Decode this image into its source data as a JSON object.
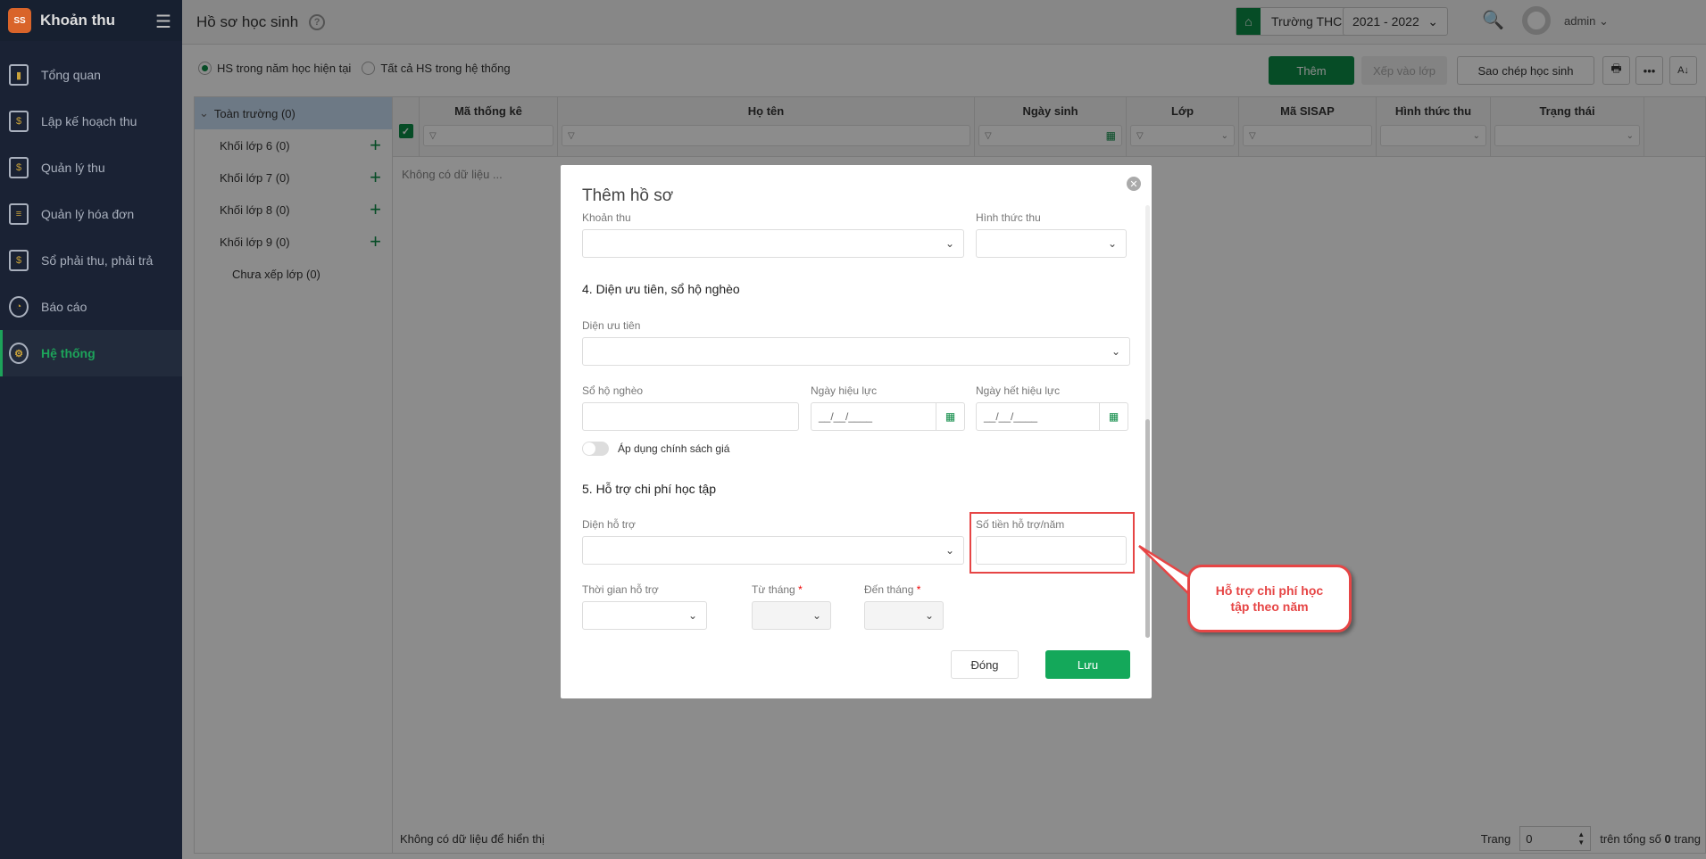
{
  "app": {
    "name": "Khoản thu",
    "logo_text": "SS"
  },
  "sidebar": {
    "items": [
      {
        "label": "Tổng quan",
        "icon": "bar-chart-icon"
      },
      {
        "label": "Lập kế hoạch thu",
        "icon": "calendar-dollar-icon"
      },
      {
        "label": "Quản lý thu",
        "icon": "money-hand-icon"
      },
      {
        "label": "Quản lý hóa đơn",
        "icon": "invoice-icon"
      },
      {
        "label": "Sổ phải thu, phải trả",
        "icon": "ledger-icon"
      },
      {
        "label": "Báo cáo",
        "icon": "pie-chart-icon"
      },
      {
        "label": "Hệ thống",
        "icon": "gear-icon",
        "active": true
      }
    ]
  },
  "header": {
    "title": "Hồ sơ học sinh",
    "help": "?",
    "school": "Trường THCS Quảng Hợp",
    "year": "2021 - 2022",
    "user": "admin"
  },
  "filters": {
    "current": "HS trong năm học hiện tại",
    "all": "Tất cả HS trong hệ thống"
  },
  "toolbar": {
    "add": "Thêm",
    "assign": "Xếp vào lớp",
    "copy": "Sao chép học sinh"
  },
  "tree": {
    "root": "Toàn trường (0)",
    "items": [
      "Khối lớp 6  (0)",
      "Khối lớp 7  (0)",
      "Khối lớp 8  (0)",
      "Khối lớp 9  (0)"
    ],
    "unassigned": "Chưa xếp lớp  (0)"
  },
  "grid": {
    "columns": [
      "Mã thống kê",
      "Họ tên",
      "Ngày sinh",
      "Lớp",
      "Mã SISAP",
      "Hình thức thu",
      "Trạng thái"
    ],
    "empty": "Không có dữ liệu ..."
  },
  "footer": {
    "empty": "Không có dữ liệu để hiển thị",
    "page_label": "Trang",
    "page": "0",
    "total_prefix": "trên tổng số",
    "total": "0",
    "total_suffix": "trang"
  },
  "modal": {
    "title": "Thêm hồ sơ",
    "khoan_thu": "Khoản thu",
    "hinh_thuc_thu": "Hình thức thu",
    "sec4": "4. Diện ưu tiên, sổ hộ nghèo",
    "dien_uu_tien": "Diện ưu tiên",
    "so_ho_ngheo": "Sổ hộ nghèo",
    "ngay_hieu_luc": "Ngày hiệu lực",
    "ngay_het_hieu_luc": "Ngày hết hiệu lực",
    "date_placeholder": "__/__/____",
    "toggle": "Áp dụng chính sách giá",
    "sec5": "5. Hỗ trợ chi phí học tập",
    "dien_ho_tro": "Diện hỗ trợ",
    "so_tien": "Số tiền hỗ trợ/năm",
    "thoi_gian": "Thời gian hỗ trợ",
    "tu_thang": "Từ tháng",
    "den_thang": "Đến tháng",
    "required": "*",
    "close": "Đóng",
    "save": "Lưu"
  },
  "callout": {
    "text": "Hỗ trợ chi phí học tập theo năm"
  },
  "colors": {
    "primary": "#0c8a45",
    "save": "#14a85a",
    "annotation": "#e64545",
    "sidebar": "#1a2234"
  }
}
